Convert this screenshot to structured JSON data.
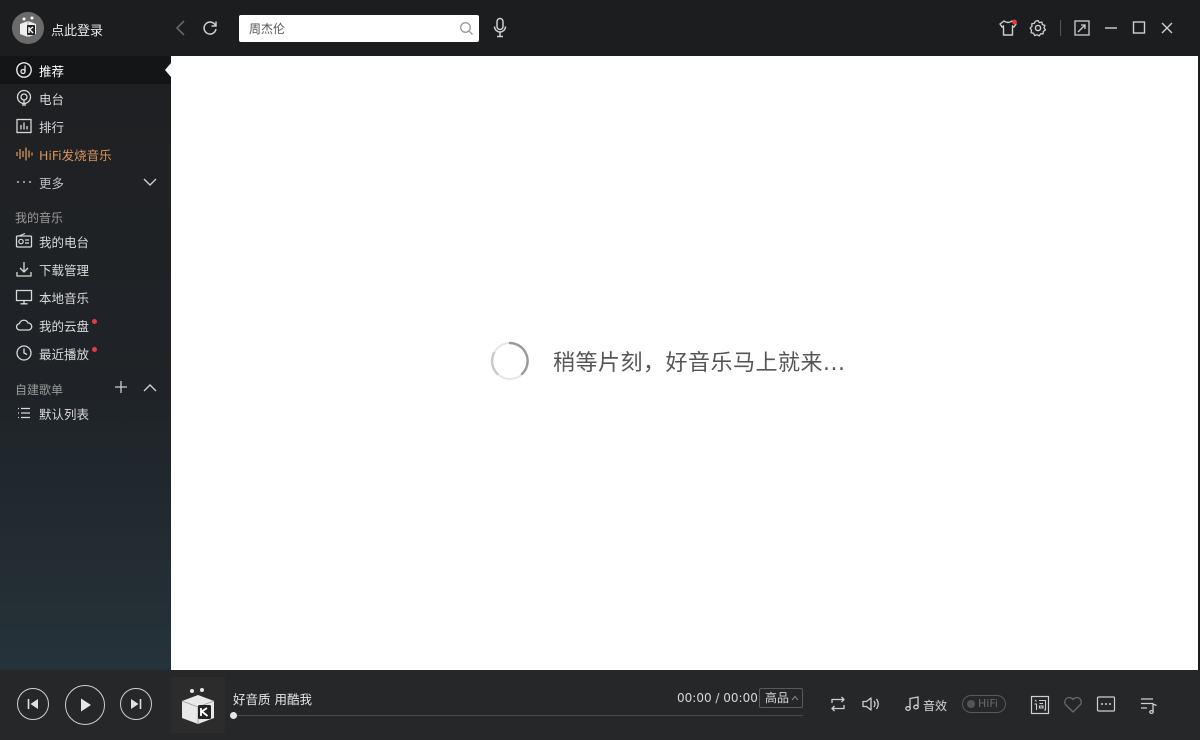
{
  "header": {
    "login_label": "点此登录",
    "search": {
      "value": "",
      "placeholder": "周杰伦"
    }
  },
  "sidebar": {
    "nav": [
      {
        "label": "推荐",
        "icon": "recommend-icon",
        "active": true
      },
      {
        "label": "电台",
        "icon": "radio-icon"
      },
      {
        "label": "排行",
        "icon": "chart-icon"
      },
      {
        "label": "HiFi发烧音乐",
        "icon": "waveform-icon"
      },
      {
        "label": "更多",
        "icon": "dots-icon"
      }
    ],
    "my_music_title": "我的音乐",
    "my_music": [
      {
        "label": "我的电台",
        "icon": "my-radio-icon"
      },
      {
        "label": "下载管理",
        "icon": "download-icon"
      },
      {
        "label": "本地音乐",
        "icon": "monitor-icon"
      },
      {
        "label": "我的云盘",
        "icon": "cloud-icon",
        "badge": true
      },
      {
        "label": "最近播放",
        "icon": "clock-icon",
        "badge": true
      }
    ],
    "playlists_title": "自建歌单",
    "playlists": [
      {
        "label": "默认列表",
        "icon": "list-icon"
      }
    ]
  },
  "main": {
    "loading_text": "稍等片刻，好音乐马上就来..."
  },
  "player": {
    "song_title": "好音质 用酷我",
    "time": "00:00 / 00:00",
    "quality": "高品",
    "effect_label": "音效",
    "hifi_label": "HiFi",
    "progress": 0
  },
  "colors": {
    "hifi_accent": "#d8935d",
    "badge": "#e8393b",
    "background_dark": "#1c1d1f"
  }
}
